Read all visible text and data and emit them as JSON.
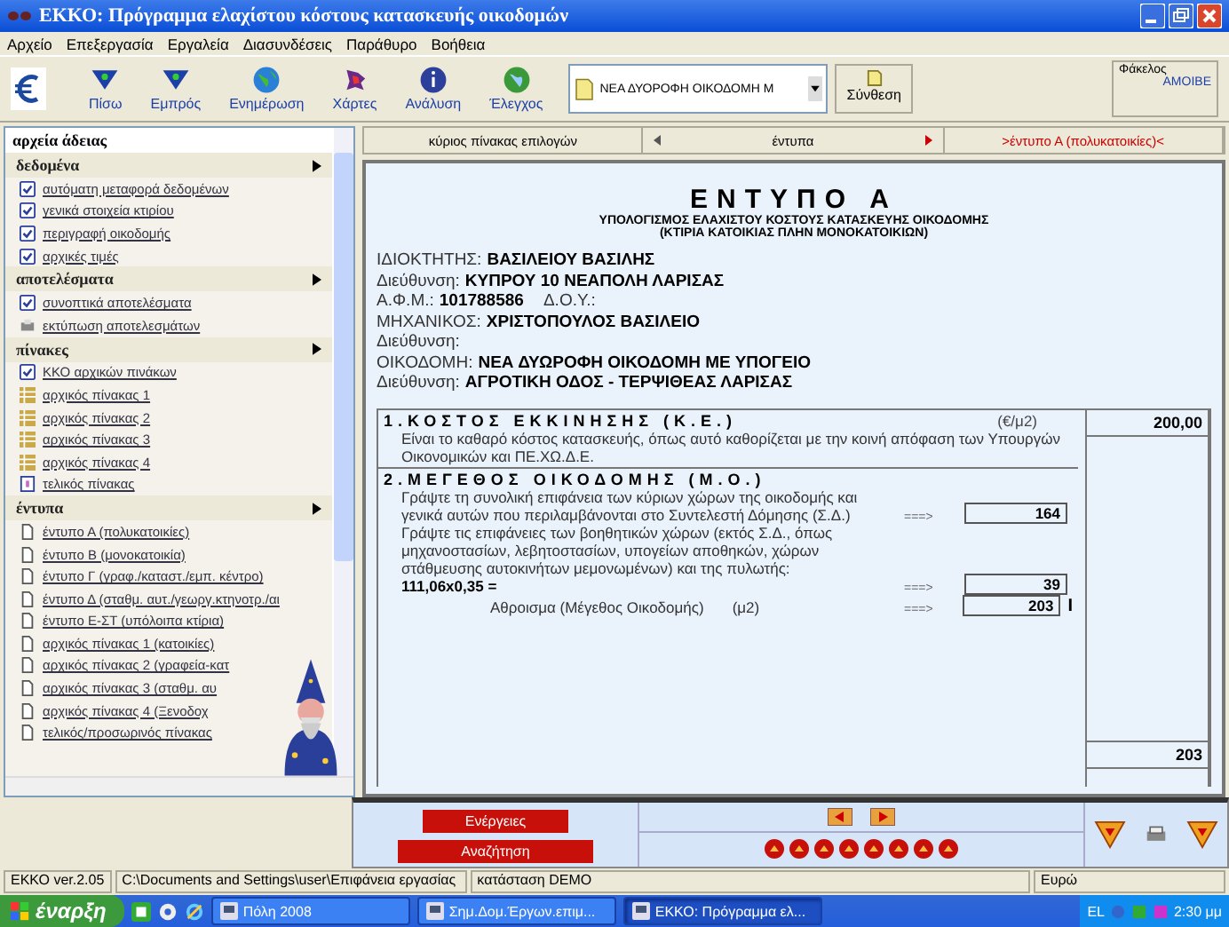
{
  "window": {
    "title": "ΕΚΚΟ: Πρόγραμμα ελαχίστου κόστους κατασκευής οικοδομών"
  },
  "menu": [
    "Αρχείο",
    "Επεξεργασία",
    "Εργαλεία",
    "Διασυνδέσεις",
    "Παράθυρο",
    "Βοήθεια"
  ],
  "toolbar": {
    "buttons": [
      {
        "kind": "back",
        "label": "Πίσω"
      },
      {
        "kind": "forward",
        "label": "Εμπρός"
      },
      {
        "kind": "globe",
        "label": "Ενημέρωση"
      },
      {
        "kind": "map",
        "label": "Χάρτες"
      },
      {
        "kind": "info",
        "label": "Ανάλυση"
      },
      {
        "kind": "check",
        "label": "Έλεγχος"
      }
    ],
    "project": "ΝΕΑ ΔΥΟΡΟΦΗ ΟΙΚΟΔΟΜΗ Μ",
    "compose": "Σύνθεση",
    "folder_label": "Φάκελος",
    "folder_value": "ΑΜΟΙΒΕ"
  },
  "sidebar": {
    "title": "αρχεία άδειας",
    "groups": [
      {
        "label": "δεδομένα",
        "items": [
          {
            "kind": "check",
            "label": "αυτόματη μεταφορά δεδομένων"
          },
          {
            "kind": "check",
            "label": "γενικά στοιχεία κτιρίου"
          },
          {
            "kind": "check",
            "label": "περιγραφή οικοδομής"
          },
          {
            "kind": "check",
            "label": "αρχικές τιμές"
          }
        ]
      },
      {
        "label": "αποτελέσματα",
        "items": [
          {
            "kind": "check",
            "label": "συνοπτικά αποτελέσματα"
          },
          {
            "kind": "printer",
            "label": "εκτύπωση αποτελεσμάτων"
          }
        ]
      },
      {
        "label": "πίνακες",
        "items": [
          {
            "kind": "check",
            "label": "ΚΚΟ αρχικών πινάκων"
          },
          {
            "kind": "table",
            "label": "αρχικός πίνακας 1"
          },
          {
            "kind": "table",
            "label": "αρχικός πίνακας 2"
          },
          {
            "kind": "table",
            "label": "αρχικός πίνακας 3"
          },
          {
            "kind": "table",
            "label": "αρχικός πίνακας 4"
          },
          {
            "kind": "sheet",
            "label": "τελικός πίνακας"
          }
        ]
      },
      {
        "label": "έντυπα",
        "items": [
          {
            "kind": "doc",
            "label": "έντυπο Α (πολυκατοικίες)"
          },
          {
            "kind": "doc",
            "label": "έντυπο Β (μονοκατοικία)"
          },
          {
            "kind": "doc",
            "label": "έντυπο Γ (γραφ./καταστ./εμπ. κέντρο)"
          },
          {
            "kind": "doc",
            "label": "έντυπο Δ (σταθμ. αυτ./γεωργ.κτηνοτρ./αι"
          },
          {
            "kind": "doc",
            "label": "έντυπο Ε-ΣΤ (υπόλοιπα κτίρια)"
          },
          {
            "kind": "doc",
            "label": "αρχικός πίνακας 1 (κατοικίες)"
          },
          {
            "kind": "doc",
            "label": "αρχικός πίνακας 2 (γραφεία-κατ"
          },
          {
            "kind": "doc",
            "label": "αρχικός πίνακας 3 (σταθμ. αυ"
          },
          {
            "kind": "doc",
            "label": "αρχικός πίνακας 4 (Ξενοδοχ"
          },
          {
            "kind": "doc",
            "label": "τελικός/προσωρινός πίνακας"
          }
        ]
      }
    ]
  },
  "breadcrumb": {
    "home": "κύριος πίνακας επιλογών",
    "section": "έντυπα",
    "current": ">έντυπο Α (πολυκατοικίες)<"
  },
  "form": {
    "title": "ΕΝΤΥΠΟ Α",
    "subtitle": "ΥΠΟΛΟΓΙΣΜΟΣ ΕΛΑΧΙΣΤΟΥ ΚΟΣΤΟΥΣ ΚΑΤΑΣΚΕΥΗΣ ΟΙΚΟΔΟΜΗΣ",
    "subtitle2": "(ΚΤΙΡΙΑ ΚΑΤΟΙΚΙΑΣ ΠΛΗΝ ΜΟΝΟΚΑΤΟΙΚΙΩΝ)",
    "fields": [
      {
        "label": "ΙΔΙΟΚΤΗΤΗΣ:",
        "value": "ΒΑΣΙΛΕΙΟΥ ΒΑΣΙΛΗΣ"
      },
      {
        "label": "Διεύθυνση:",
        "value": "ΚΥΠΡΟΥ 10 ΝΕΑΠΟΛΗ ΛΑΡΙΣΑΣ"
      },
      {
        "label": "Α.Φ.Μ.:",
        "value": "101788586",
        "extra": "Δ.Ο.Υ.:"
      },
      {
        "label": "ΜΗΧΑΝΙΚΟΣ:",
        "value": "ΧΡΙΣΤΟΠΟΥΛΟΣ ΒΑΣΙΛΕΙΟ"
      },
      {
        "label": "Διεύθυνση:"
      },
      {
        "label": "ΟΙΚΟΔΟΜΗ:",
        "value": "ΝΕΑ ΔΥΩΡΟΦΗ ΟΙΚΟΔΟΜΗ ΜΕ ΥΠΟΓΕΙΟ"
      },
      {
        "label": "Διεύθυνση:",
        "value": "ΑΓΡΟΤΙΚΗ ΟΔΟΣ - ΤΕΡΨΙΘΕΑΣ ΛΑΡΙΣΑΣ"
      }
    ],
    "section1": {
      "heading": "1.ΚΟΣΤΟΣ ΕΚΚΙΝΗΣΗΣ (Κ.Ε.)",
      "unit": "(€/μ2)",
      "text": "Είναι το καθαρό κόστος κατασκευής, όπως αυτό καθορίζεται με την κοινή απόφαση των Υπουργών Οικονομικών και ΠΕ.ΧΩ.Δ.Ε.",
      "value": "200,00"
    },
    "section2": {
      "heading": "2.ΜΕΓΕΘΟΣ ΟΙΚΟΔΟΜΗΣ (Μ.Ο.)",
      "text1": "Γράψτε τη συνολική επιφάνεια των κύριων χώρων της οικοδομής και γενικά αυτών που περιλαμβάνονται στο Συντελεστή Δόμησης (Σ.Δ.)",
      "arrow1": "===>",
      "value1": "164",
      "text2": "Γράψτε τις επιφάνειες των βοηθητικών χώρων (εκτός Σ.Δ., όπως μηχανοστασίων, λεβητοστασίων, υπογείων αποθηκών, χώρων στάθμευσης αυτοκινήτων μεμονωμένων) και της πυλωτής:",
      "formula": "111,06x0,35 =",
      "arrow2": "===>",
      "value2": "39",
      "sum_label": "Αθροισμα (Μέγεθος Οικοδομής)",
      "sum_unit": "(μ2)",
      "arrow3": "===>",
      "sum": "203",
      "marker": "I",
      "total": "203"
    }
  },
  "actions": {
    "primary": "Ενέργειες",
    "secondary": "Αναζήτηση"
  },
  "status_bar": [
    "ΕΚΚΟ ver.2.05",
    "C:\\Documents and Settings\\user\\Επιφάνεια εργασίας",
    "κατάσταση DEMO",
    "Ευρώ"
  ],
  "taskbar": {
    "start": "έναρξη",
    "tasks": [
      {
        "label": "Πόλη 2008",
        "selected": false
      },
      {
        "label": "Σημ.Δομ.Έργων.επιμ...",
        "selected": false
      },
      {
        "label": "ΕΚΚΟ: Πρόγραμμα ελ...",
        "selected": true
      }
    ],
    "language": "EL",
    "clock": "2:30 μμ"
  }
}
